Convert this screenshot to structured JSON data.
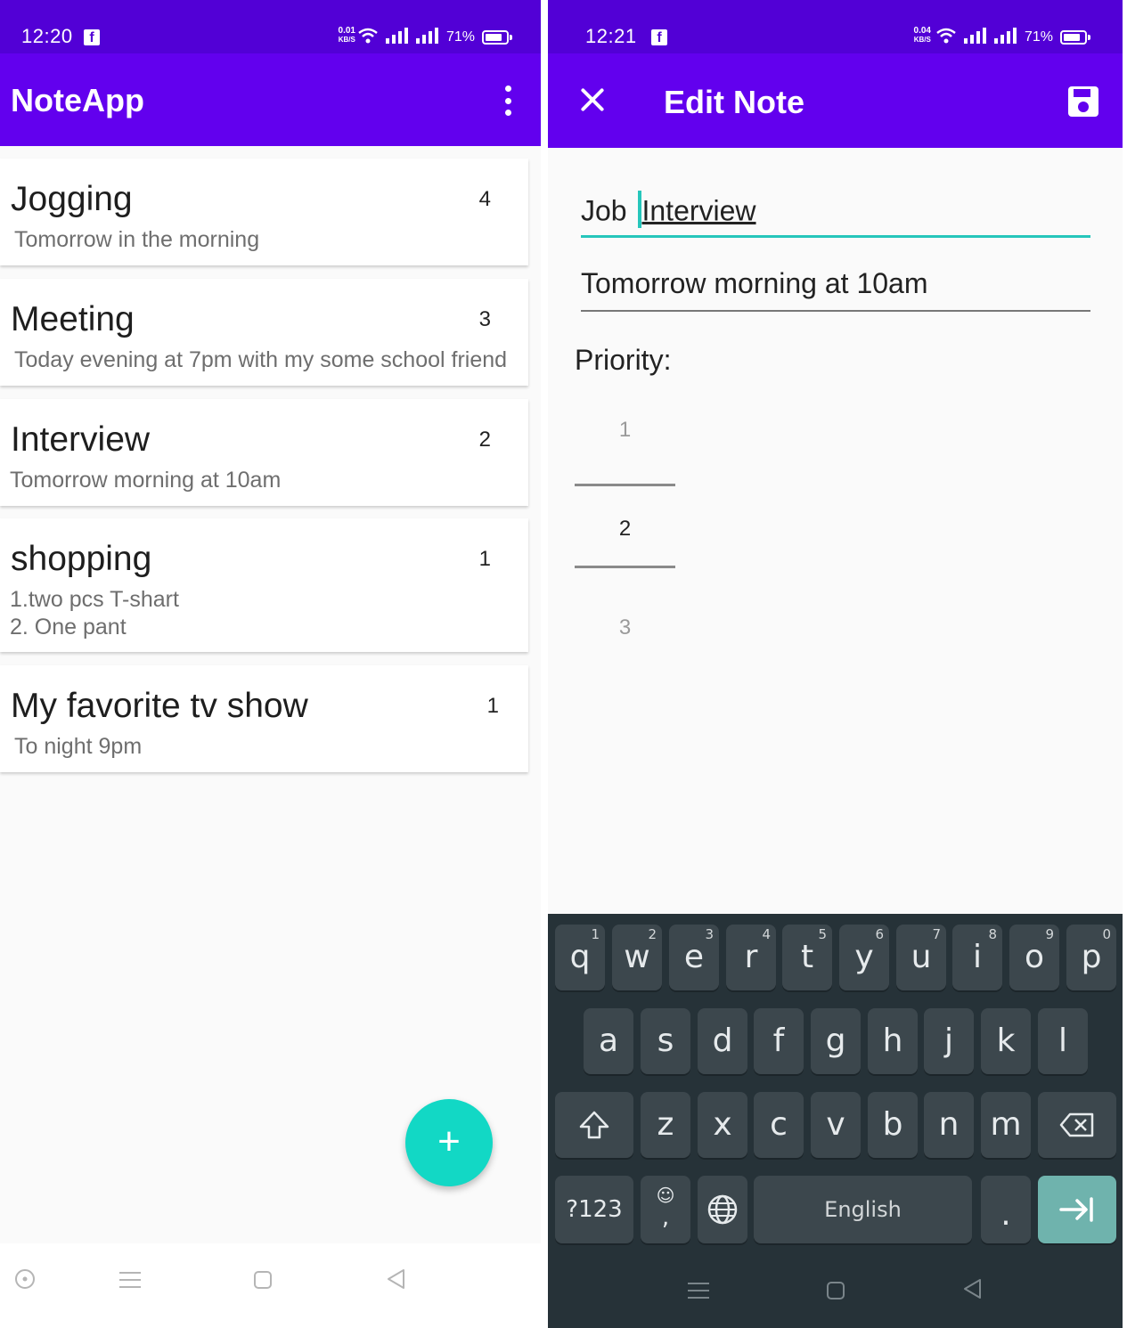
{
  "left_screen": {
    "status": {
      "time": "12:20",
      "network_speed_value": "0.01",
      "network_speed_unit": "KB/S",
      "battery": "71%"
    },
    "app_title": "NoteApp",
    "notes": [
      {
        "title": "Jogging",
        "description": "Tomorrow in the morning",
        "priority": "4"
      },
      {
        "title": "Meeting",
        "description": "Today evening at 7pm with my some school friend",
        "priority": "3"
      },
      {
        "title": "Interview",
        "description": "Tomorrow morning at 10am",
        "priority": "2"
      },
      {
        "title": "shopping",
        "description": "1.two pcs T-shart\n2. One pant",
        "priority": "1"
      },
      {
        "title": "My favorite tv show",
        "description": "To night 9pm",
        "priority": "1"
      }
    ],
    "fab_label": "+",
    "nav_icons": [
      "assistant-icon",
      "menu-icon",
      "home-icon",
      "back-icon"
    ]
  },
  "right_screen": {
    "status": {
      "time": "12:21",
      "network_speed_value": "0.04",
      "network_speed_unit": "KB/S",
      "battery": "71%"
    },
    "title": "Edit Note",
    "title_input": {
      "before_caret": "Job ",
      "after_caret": "Interview"
    },
    "description_input": "Tomorrow morning at 10am",
    "priority_label": "Priority:",
    "priority_picker": {
      "above": "1",
      "selected": "2",
      "below": "3"
    },
    "keyboard": {
      "row1": [
        {
          "key": "q",
          "hint": "1"
        },
        {
          "key": "w",
          "hint": "2"
        },
        {
          "key": "e",
          "hint": "3"
        },
        {
          "key": "r",
          "hint": "4"
        },
        {
          "key": "t",
          "hint": "5"
        },
        {
          "key": "y",
          "hint": "6"
        },
        {
          "key": "u",
          "hint": "7"
        },
        {
          "key": "i",
          "hint": "8"
        },
        {
          "key": "o",
          "hint": "9"
        },
        {
          "key": "p",
          "hint": "0"
        }
      ],
      "row2": [
        "a",
        "s",
        "d",
        "f",
        "g",
        "h",
        "j",
        "k",
        "l"
      ],
      "row3": [
        "z",
        "x",
        "c",
        "v",
        "b",
        "n",
        "m"
      ],
      "symbols_label": "?123",
      "comma_label": ",",
      "space_label": "English",
      "period_label": "."
    }
  },
  "colors": {
    "status_bar": "#5200d6",
    "app_bar": "#6200ee",
    "accent": "#12d8c5",
    "keyboard_bg": "#263238",
    "key_bg": "#3c474d",
    "enter_key": "#6fb3ad"
  }
}
